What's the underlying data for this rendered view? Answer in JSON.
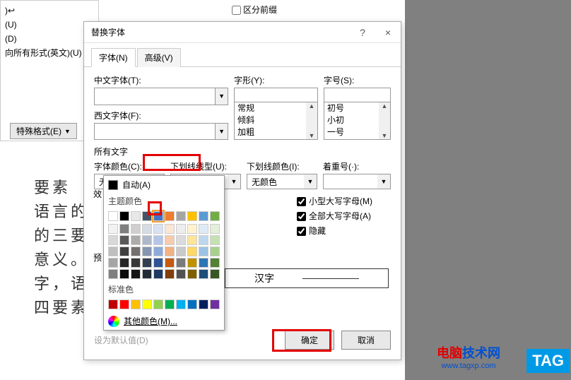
{
  "bg": {
    "checkbox_label": "区分前缀",
    "left_items": [
      ")↩",
      "(U)",
      "(D)",
      "向所有形式(英文)(U)"
    ],
    "special_btn": "特殊格式(E)"
  },
  "dialog": {
    "title": "替换字体",
    "help": "?",
    "close": "×",
    "tabs": {
      "tab1": "字体(N)",
      "tab2": "高级(V)"
    },
    "chinese_font": {
      "label": "中文字体(T):"
    },
    "western_font": {
      "label": "西文字体(F):"
    },
    "font_style": {
      "label": "字形(Y):",
      "items": [
        "常规",
        "倾斜",
        "加粗"
      ]
    },
    "font_size": {
      "label": "字号(S):",
      "items": [
        "初号",
        "小初",
        "一号"
      ]
    },
    "all_text": "所有文字",
    "font_color": {
      "label": "字体颜色(C):",
      "value": "无颜色"
    },
    "underline_style": {
      "label": "下划线线型(U):"
    },
    "underline_color": {
      "label": "下划线颜色(I):",
      "value": "无颜色"
    },
    "emphasis": {
      "label": "着重号(·):"
    },
    "effects_label": "效",
    "preview_label": "预",
    "preview_text": "汉字",
    "checkboxes": {
      "small_caps": "小型大写字母(M)",
      "all_caps": "全部大写字母(A)",
      "hidden": "隐藏"
    },
    "set_default": "设为默认值(D)",
    "ok": "确定",
    "cancel": "取消"
  },
  "color_picker": {
    "auto": "自动(A)",
    "theme": "主题颜色",
    "standard": "标准色",
    "more": "其他颜色(M)...",
    "theme_row1": [
      "#ffffff",
      "#000000",
      "#e8e8e8",
      "#445568",
      "#4472c4",
      "#ed7d31",
      "#a5a5a5",
      "#ffc000",
      "#5b9bd5",
      "#70ad47"
    ],
    "theme_shades": [
      [
        "#f2f2f2",
        "#7f7f7f",
        "#d0cece",
        "#d6dce4",
        "#d9e2f3",
        "#fbe5d5",
        "#ededed",
        "#fff2cc",
        "#deebf6",
        "#e2efd9"
      ],
      [
        "#d8d8d8",
        "#595959",
        "#aeabab",
        "#adb9ca",
        "#b4c6e7",
        "#f7cbac",
        "#dbdbdb",
        "#fee599",
        "#bdd7ee",
        "#c5e0b3"
      ],
      [
        "#bfbfbf",
        "#3f3f3f",
        "#757070",
        "#8496b0",
        "#8eaadb",
        "#f4b183",
        "#c9c9c9",
        "#ffd965",
        "#9cc3e5",
        "#a8d08d"
      ],
      [
        "#a5a5a5",
        "#262626",
        "#3a3838",
        "#323f4f",
        "#2f5496",
        "#c55a11",
        "#7b7b7b",
        "#bf9000",
        "#2e75b5",
        "#538135"
      ],
      [
        "#7f7f7f",
        "#0c0c0c",
        "#171616",
        "#222a35",
        "#1f3864",
        "#833c0b",
        "#525252",
        "#7f6000",
        "#1e4e79",
        "#375623"
      ]
    ],
    "standard_row": [
      "#c00000",
      "#ff0000",
      "#ffc000",
      "#ffff00",
      "#92d050",
      "#00b050",
      "#00b0f0",
      "#0070c0",
      "#002060",
      "#7030a0"
    ]
  },
  "doc_text": [
    "要素",
    "语言的",
    "的三要",
    "意义。",
    "字，语",
    "四要素"
  ],
  "watermark": {
    "title_red": "电脑",
    "title_blue": "技术网",
    "url": "www.tagxp.com",
    "badge": "TAG"
  }
}
